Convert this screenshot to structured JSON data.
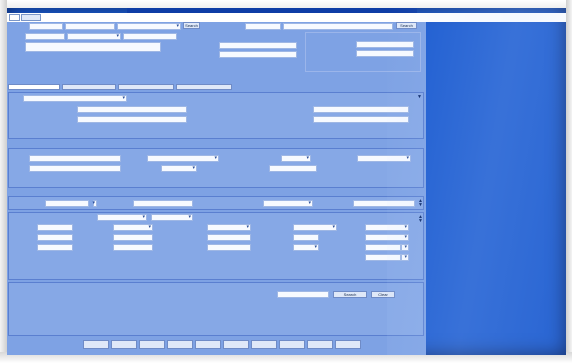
{
  "window": {
    "title": ""
  },
  "tabs": [
    {
      "label": ""
    },
    {
      "label": ""
    }
  ],
  "header": {
    "search_button": "Search",
    "search_button_right": "Search"
  },
  "sections": {
    "address": {
      "heading": ""
    },
    "incident": {
      "heading": ""
    },
    "vehicle": {
      "heading": ""
    },
    "person": {
      "heading": ""
    }
  },
  "subtabs": [
    {
      "label": ""
    },
    {
      "label": ""
    },
    {
      "label": ""
    },
    {
      "label": ""
    }
  ],
  "person": {
    "search_button": "Search",
    "clear_button": "Clear"
  },
  "footer": {
    "status_line_1": "",
    "status_line_2": "",
    "buttons": [
      {
        "label": ""
      },
      {
        "label": ""
      },
      {
        "label": ""
      },
      {
        "label": ""
      },
      {
        "label": ""
      },
      {
        "label": ""
      },
      {
        "label": ""
      },
      {
        "label": ""
      },
      {
        "label": ""
      },
      {
        "label": ""
      }
    ]
  }
}
